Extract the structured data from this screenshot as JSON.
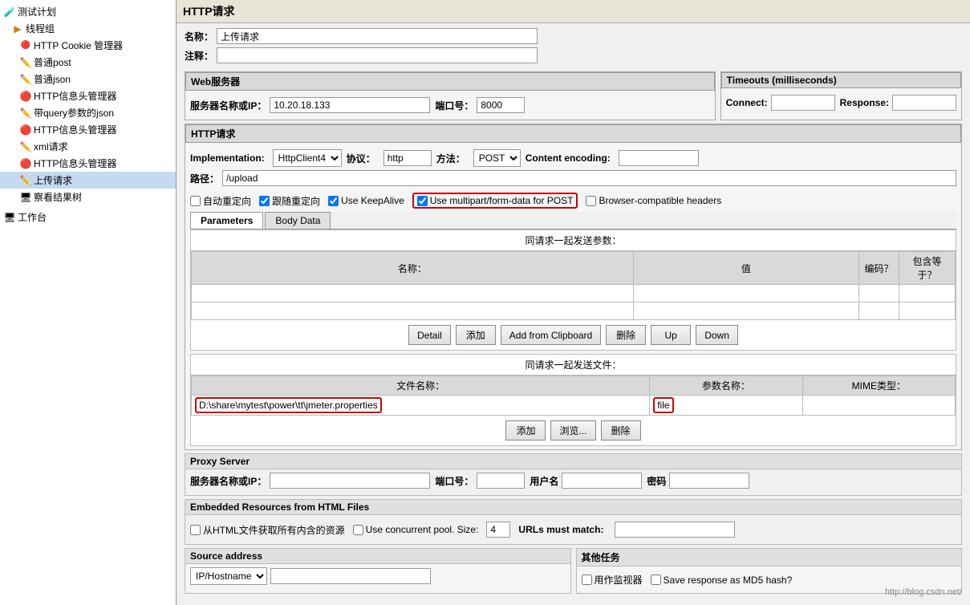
{
  "sidebar": {
    "items": [
      {
        "id": "test-plan",
        "label": "测试计划",
        "indent": 0,
        "icon": "test"
      },
      {
        "id": "thread-group",
        "label": "线程组",
        "indent": 1,
        "icon": "thread"
      },
      {
        "id": "http-cookie",
        "label": "HTTP Cookie 管理器",
        "indent": 2,
        "icon": "red"
      },
      {
        "id": "putong-post",
        "label": "普通post",
        "indent": 2,
        "icon": "pencil"
      },
      {
        "id": "putong-json",
        "label": "普通json",
        "indent": 2,
        "icon": "pencil"
      },
      {
        "id": "http-info1",
        "label": "HTTP信息头管理器",
        "indent": 2,
        "icon": "red"
      },
      {
        "id": "query-json",
        "label": "带query参数的json",
        "indent": 2,
        "icon": "pencil"
      },
      {
        "id": "http-info2",
        "label": "HTTP信息头管理器",
        "indent": 2,
        "icon": "red"
      },
      {
        "id": "xml-request",
        "label": "xml请求",
        "indent": 2,
        "icon": "pencil"
      },
      {
        "id": "http-info3",
        "label": "HTTP信息头管理器",
        "indent": 2,
        "icon": "red"
      },
      {
        "id": "upload-request",
        "label": "上传请求",
        "indent": 2,
        "icon": "pencil",
        "selected": true
      },
      {
        "id": "check-results",
        "label": "察看结果树",
        "indent": 2,
        "icon": "desktop"
      }
    ]
  },
  "panel": {
    "title": "HTTP请求",
    "name_label": "名称：",
    "name_value": "上传请求",
    "comment_label": "注释：",
    "comment_value": ""
  },
  "web_server": {
    "section_title": "Web服务器",
    "server_label": "服务器名称或IP：",
    "server_value": "10.20.18.133",
    "port_label": "端口号：",
    "port_value": "8000"
  },
  "timeouts": {
    "section_title": "Timeouts (milliseconds)",
    "connect_label": "Connect:",
    "connect_value": "",
    "response_label": "Response:",
    "response_value": ""
  },
  "http_request": {
    "section_title": "HTTP请求",
    "implementation_label": "Implementation:",
    "implementation_value": "HttpClient4",
    "protocol_label": "协议：",
    "protocol_value": "http",
    "method_label": "方法：",
    "method_value": "POST",
    "encoding_label": "Content encoding:",
    "encoding_value": "",
    "path_label": "路径：",
    "path_value": "/upload"
  },
  "checkboxes": {
    "auto_redirect": "自动重定向",
    "auto_redirect_checked": false,
    "follow_redirect": "跟随重定向",
    "follow_redirect_checked": true,
    "keep_alive": "Use KeepAlive",
    "keep_alive_checked": true,
    "multipart": "Use multipart/form-data for POST",
    "multipart_checked": true,
    "browser_headers": "Browser-compatible headers",
    "browser_headers_checked": false
  },
  "tabs": {
    "parameters": "Parameters",
    "body_data": "Body Data",
    "active": "parameters"
  },
  "params_table": {
    "header_same_request": "同请求一起发送参数：",
    "col_name": "名称：",
    "col_value": "值",
    "col_encode": "编码？",
    "col_include": "包含等于？",
    "rows": []
  },
  "param_buttons": {
    "detail": "Detail",
    "add": "添加",
    "add_from_clipboard": "Add from Clipboard",
    "delete": "删除",
    "up": "Up",
    "down": "Down"
  },
  "files_table": {
    "header_same_request": "同请求一起发送文件：",
    "col_filename": "文件名称：",
    "col_param_name": "参数名称：",
    "col_mime": "MIME类型：",
    "rows": [
      {
        "filename": "D:\\share\\mytest\\power\\tt\\jmeter.properties",
        "param_name": "file",
        "mime": ""
      }
    ]
  },
  "file_buttons": {
    "add": "添加",
    "browse": "浏览...",
    "delete": "删除"
  },
  "proxy": {
    "section_title": "Proxy Server",
    "server_label": "服务器名称或IP：",
    "server_value": "",
    "port_label": "端口号：",
    "port_value": "",
    "username_label": "用户名",
    "username_value": "",
    "password_label": "密码",
    "password_value": ""
  },
  "embedded": {
    "section_title": "Embedded Resources from HTML Files",
    "extract_label": "从HTML文件获取所有内含的资源",
    "extract_checked": false,
    "concurrent_label": "Use concurrent pool. Size:",
    "concurrent_checked": false,
    "concurrent_size": "4",
    "urls_label": "URLs must match:",
    "urls_value": ""
  },
  "source": {
    "section_title": "Source address",
    "ip_hostname_label": "IP/Hostname",
    "ip_value": "",
    "other_tasks_title": "其他任务",
    "monitor_label": "用作监视器",
    "monitor_checked": false,
    "md5_label": "Save response as MD5 hash?",
    "md5_checked": false
  },
  "watermark": "http://blog.csdn.net/"
}
